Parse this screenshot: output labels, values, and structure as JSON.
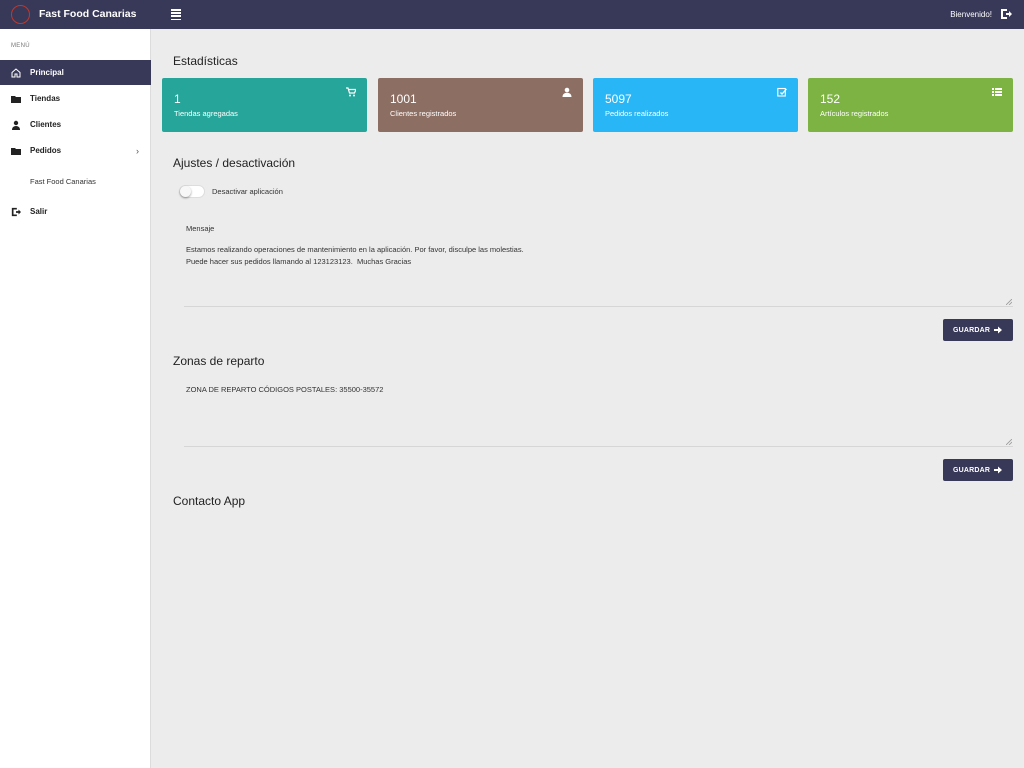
{
  "header": {
    "title": "Fast Food Canarias",
    "welcome": "Bienvenido!"
  },
  "sidebar": {
    "caption": "MENÚ",
    "items": [
      {
        "label": "Principal",
        "icon": "home-icon",
        "active": true
      },
      {
        "label": "Tiendas",
        "icon": "folder-icon"
      },
      {
        "label": "Clientes",
        "icon": "user-icon"
      },
      {
        "label": "Pedidos",
        "icon": "folder-icon",
        "submenu_indicator": "›"
      },
      {
        "label": "Fast Food Canarias"
      },
      {
        "label": "Salir",
        "icon": "logout-icon"
      }
    ]
  },
  "main": {
    "stats_title": "Estadísticas",
    "stats": [
      {
        "value": "1",
        "label": "Tiendas agregadas",
        "color": "#26a69a",
        "icon": "cart-icon"
      },
      {
        "value": "1001",
        "label": "Clientes registrados",
        "color": "#8d6e63",
        "icon": "user-icon"
      },
      {
        "value": "5097",
        "label": "Pedidos realizados",
        "color": "#29b6f6",
        "icon": "edit-icon"
      },
      {
        "value": "152",
        "label": "Artículos registrados",
        "color": "#7cb342",
        "icon": "list-icon"
      }
    ],
    "settings_title": "Ajustes / desactivación",
    "toggle_label": "Desactivar aplicación",
    "message_label": "Mensaje",
    "message_lines": [
      "Estamos realizando operaciones de mantenimiento en la aplicación. Por favor, disculpe las molestias.",
      "Puede hacer sus pedidos llamando al 123123123.  Muchas Gracias"
    ],
    "save_label": "GUARDAR",
    "zones_title": "Zonas de reparto",
    "zones_text": "ZONA DE REPARTO CÓDIGOS POSTALES: 35500-35572",
    "contact_title": "Contacto App"
  },
  "colors": {
    "primary": "#383859",
    "background": "#ececec"
  }
}
